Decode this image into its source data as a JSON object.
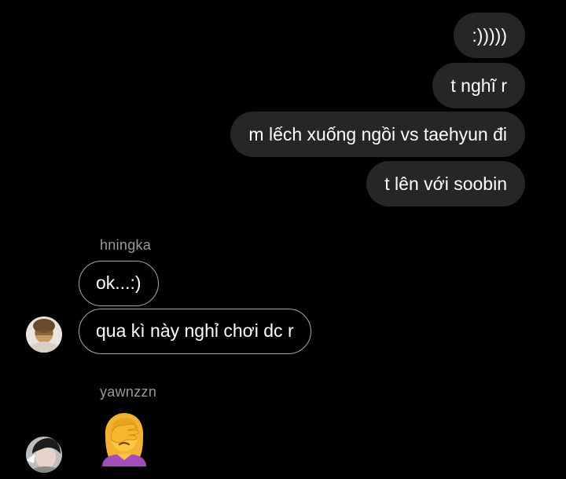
{
  "sent_messages": [
    {
      "text": ":)))))"
    },
    {
      "text": "t nghĩ r"
    },
    {
      "text": "m lếch xuống ngồi vs taehyun đi"
    },
    {
      "text": "t lên với soobin"
    }
  ],
  "thread": [
    {
      "sender": "hningka",
      "messages": [
        "ok...:)",
        "qua kì này nghỉ chơi dc r"
      ]
    },
    {
      "sender": "yawnzzn",
      "emoji": "woman-facepalming"
    }
  ],
  "colors": {
    "background": "#000000",
    "sent_bubble": "#262629",
    "received_border": "#a8a8a8",
    "sender_name": "#9a9a9a"
  }
}
